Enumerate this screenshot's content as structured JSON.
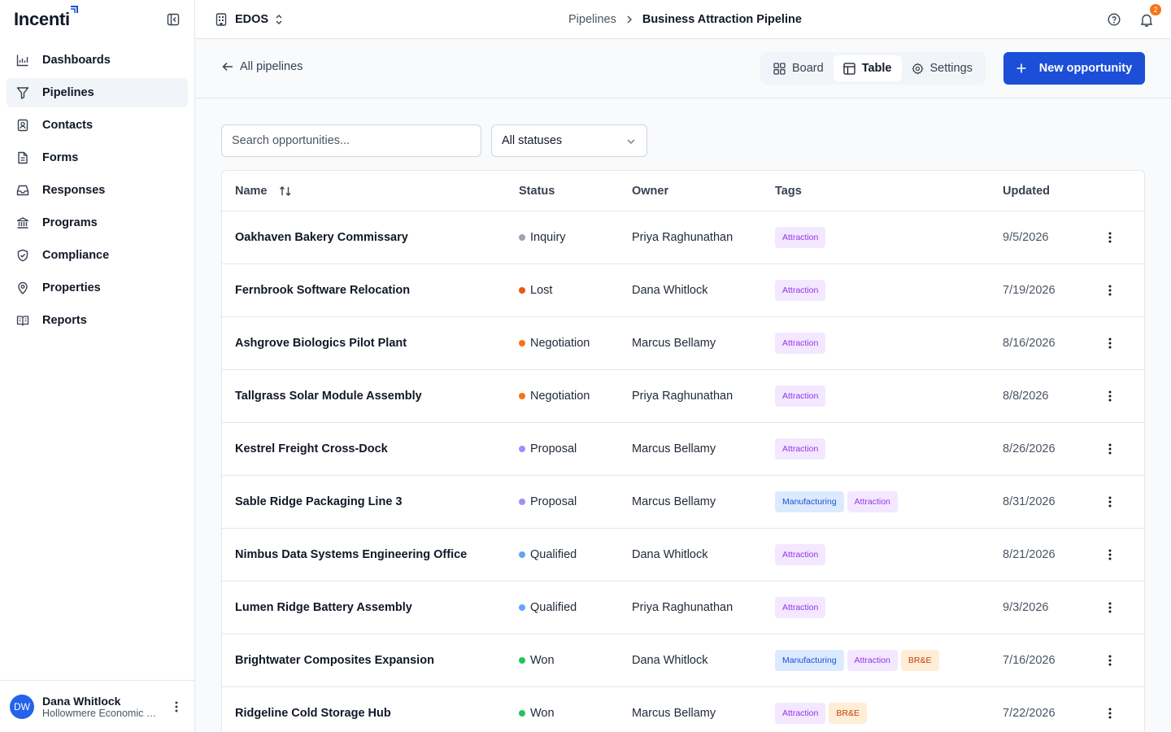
{
  "brand": {
    "name": "Incenti"
  },
  "colors": {
    "primary": "#1d4ed8",
    "sidebar_active": "#f1f5f9",
    "badge": "#f97316"
  },
  "sidebar": {
    "items": [
      {
        "label": "Dashboards",
        "icon": "chart-icon"
      },
      {
        "label": "Pipelines",
        "icon": "filter-icon",
        "active": true
      },
      {
        "label": "Contacts",
        "icon": "contact-book-icon"
      },
      {
        "label": "Forms",
        "icon": "document-icon"
      },
      {
        "label": "Responses",
        "icon": "inbox-icon"
      },
      {
        "label": "Programs",
        "icon": "bank-icon"
      },
      {
        "label": "Compliance",
        "icon": "shield-check-icon"
      },
      {
        "label": "Properties",
        "icon": "map-pin-icon"
      },
      {
        "label": "Reports",
        "icon": "book-open-icon"
      }
    ],
    "user": {
      "initials": "DW",
      "name": "Dana Whitlock",
      "org": "Hollowmere Economic Development"
    }
  },
  "topbar": {
    "org": "EDOS",
    "breadcrumb": {
      "parent": "Pipelines",
      "current": "Business Attraction Pipeline"
    },
    "notifications_count": "2"
  },
  "subheader": {
    "back_label": "All pipelines",
    "tabs": [
      {
        "label": "Board",
        "icon": "grid-icon"
      },
      {
        "label": "Table",
        "icon": "table-icon",
        "active": true
      },
      {
        "label": "Settings",
        "icon": "gear-icon"
      }
    ],
    "new_button": "New opportunity"
  },
  "filters": {
    "search_placeholder": "Search opportunities...",
    "status_value": "All statuses"
  },
  "table": {
    "columns": {
      "name": "Name",
      "status": "Status",
      "owner": "Owner",
      "tags": "Tags",
      "updated": "Updated"
    },
    "status_colors": {
      "Inquiry": "#9ca3af",
      "Lost": "#ea580c",
      "Negotiation": "#f97316",
      "Proposal": "#a78bfa",
      "Qualified": "#60a5fa",
      "Won": "#22c55e"
    },
    "tag_styles": {
      "Attraction": {
        "bg": "#f3e8ff",
        "fg": "#9333ea"
      },
      "Manufacturing": {
        "bg": "#dbeafe",
        "fg": "#1d4ed8"
      },
      "BR&E": {
        "bg": "#ffedd5",
        "fg": "#c2410c"
      }
    },
    "rows": [
      {
        "name": "Oakhaven Bakery Commissary",
        "status": "Inquiry",
        "owner": "Priya Raghunathan",
        "tags": [
          "Attraction"
        ],
        "updated": "9/5/2026"
      },
      {
        "name": "Fernbrook Software Relocation",
        "status": "Lost",
        "owner": "Dana Whitlock",
        "tags": [
          "Attraction"
        ],
        "updated": "7/19/2026"
      },
      {
        "name": "Ashgrove Biologics Pilot Plant",
        "status": "Negotiation",
        "owner": "Marcus Bellamy",
        "tags": [
          "Attraction"
        ],
        "updated": "8/16/2026"
      },
      {
        "name": "Tallgrass Solar Module Assembly",
        "status": "Negotiation",
        "owner": "Priya Raghunathan",
        "tags": [
          "Attraction"
        ],
        "updated": "8/8/2026"
      },
      {
        "name": "Kestrel Freight Cross-Dock",
        "status": "Proposal",
        "owner": "Marcus Bellamy",
        "tags": [
          "Attraction"
        ],
        "updated": "8/26/2026"
      },
      {
        "name": "Sable Ridge Packaging Line 3",
        "status": "Proposal",
        "owner": "Marcus Bellamy",
        "tags": [
          "Manufacturing",
          "Attraction"
        ],
        "updated": "8/31/2026"
      },
      {
        "name": "Nimbus Data Systems Engineering Office",
        "status": "Qualified",
        "owner": "Dana Whitlock",
        "tags": [
          "Attraction"
        ],
        "updated": "8/21/2026"
      },
      {
        "name": "Lumen Ridge Battery Assembly",
        "status": "Qualified",
        "owner": "Priya Raghunathan",
        "tags": [
          "Attraction"
        ],
        "updated": "9/3/2026"
      },
      {
        "name": "Brightwater Composites Expansion",
        "status": "Won",
        "owner": "Dana Whitlock",
        "tags": [
          "Manufacturing",
          "Attraction",
          "BR&E"
        ],
        "updated": "7/16/2026"
      },
      {
        "name": "Ridgeline Cold Storage Hub",
        "status": "Won",
        "owner": "Marcus Bellamy",
        "tags": [
          "Attraction",
          "BR&E"
        ],
        "updated": "7/22/2026"
      }
    ]
  }
}
